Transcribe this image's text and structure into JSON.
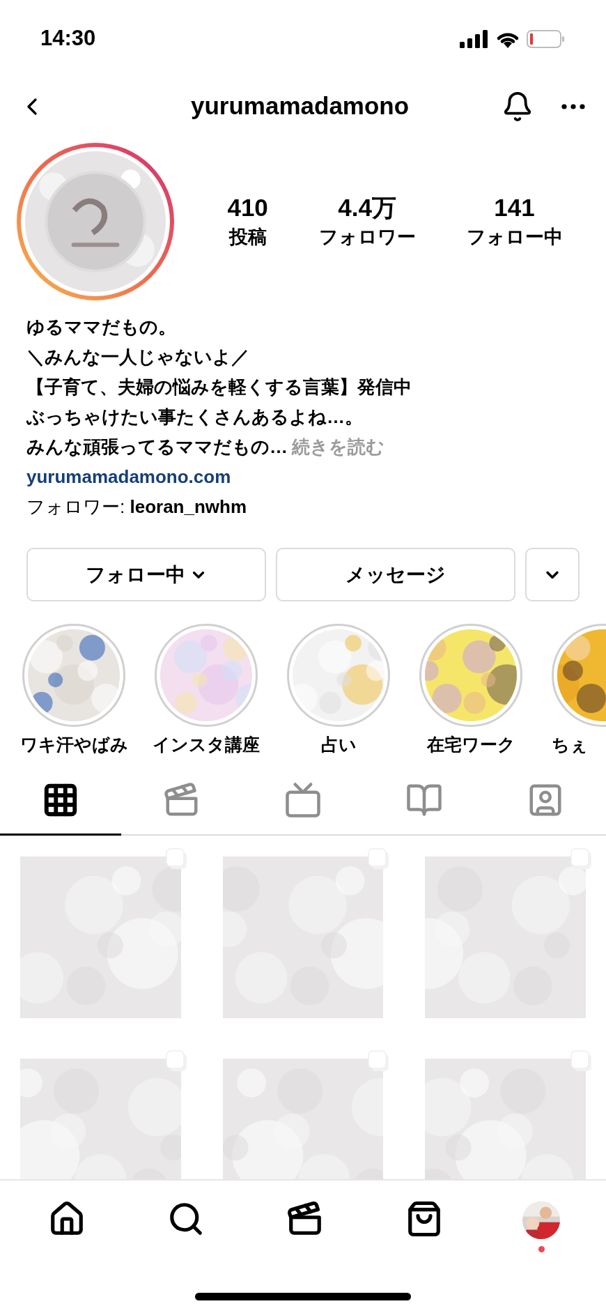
{
  "status_bar": {
    "time": "14:30"
  },
  "header": {
    "username": "yurumamadamono"
  },
  "profile": {
    "avatar": {
      "kind": "picture",
      "story_ring": true
    },
    "stats": [
      {
        "value": "410",
        "label": "投稿"
      },
      {
        "value": "4.4万",
        "label": "フォロワー"
      },
      {
        "value": "141",
        "label": "フォロー中"
      }
    ]
  },
  "bio": {
    "name": "ゆるママだもの。",
    "lines": [
      "＼みんな一人じゃないよ／",
      "【子育て、夫婦の悩みを軽くする言葉】発信中",
      "ぶっちゃけたい事たくさんあるよね…。",
      "みんな頑張ってるママだもの…"
    ],
    "more": "続きを読む",
    "link": "yurumamadamono.com",
    "followed_by": "フォロワー: **leoran_nwhm**"
  },
  "buttons": [
    {
      "kind": "dropdown",
      "label": "フォロー中"
    },
    {
      "kind": "plain",
      "label": "メッセージ"
    },
    {
      "kind": "caret"
    }
  ],
  "highlights": [
    {
      "label": "ワキ汗やばみ"
    },
    {
      "label": "インスタ講座"
    },
    {
      "label": "占い"
    },
    {
      "label": "在宅ワーク"
    },
    {
      "label": "ちぇ"
    }
  ],
  "tabs": [
    {
      "kind": "grid",
      "selected": true
    },
    {
      "kind": "reels",
      "selected": false
    },
    {
      "kind": "tv",
      "selected": false
    },
    {
      "kind": "guide",
      "selected": false
    },
    {
      "kind": "tagged",
      "selected": false
    }
  ],
  "posts": [
    {
      "kind": "carousel"
    },
    {
      "kind": "carousel"
    },
    {
      "kind": "carousel"
    },
    {
      "kind": "carousel"
    },
    {
      "kind": "carousel"
    },
    {
      "kind": "carousel"
    }
  ],
  "bottom_nav": [
    {
      "kind": "home"
    },
    {
      "kind": "search"
    },
    {
      "kind": "reels"
    },
    {
      "kind": "shop"
    },
    {
      "kind": "profile",
      "notification": true
    }
  ]
}
